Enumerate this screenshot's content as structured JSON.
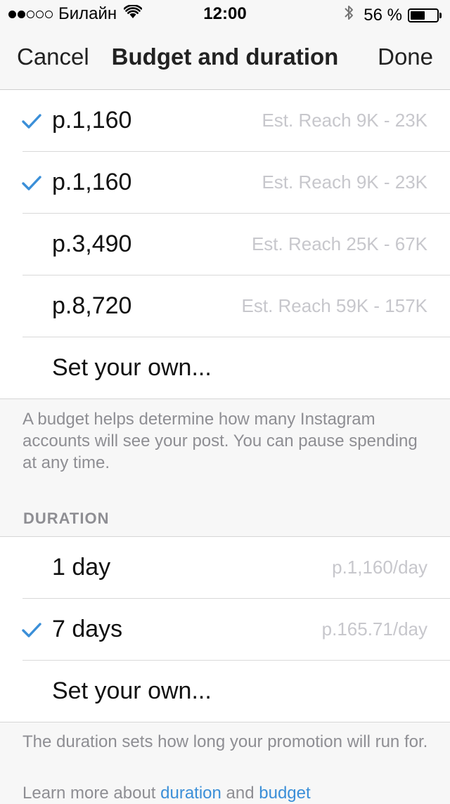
{
  "status_bar": {
    "carrier": "Билайн",
    "time": "12:00",
    "battery_percent": "56 %",
    "battery_level": 0.56,
    "signal_dots_filled": 2,
    "signal_dots_total": 5
  },
  "nav": {
    "cancel_label": "Cancel",
    "title": "Budget and duration",
    "done_label": "Done"
  },
  "budget": {
    "options": [
      {
        "label": "p.1,160",
        "detail": "Est. Reach 9K - 23K",
        "checked": true
      },
      {
        "label": "p.1,160",
        "detail": "Est. Reach 9K - 23K",
        "checked": true
      },
      {
        "label": "p.3,490",
        "detail": "Est. Reach 25K - 67K",
        "checked": false
      },
      {
        "label": "p.8,720",
        "detail": "Est. Reach 59K - 157K",
        "checked": false
      }
    ],
    "set_own_label": "Set your own...",
    "footer": "A budget helps determine how many Instagram accounts will see your post. You can pause spending at any time."
  },
  "duration": {
    "header": "DURATION",
    "options": [
      {
        "label": "1 day",
        "detail": "p.1,160/day",
        "checked": false
      },
      {
        "label": "7 days",
        "detail": "p.165.71/day",
        "checked": true
      }
    ],
    "set_own_label": "Set your own...",
    "footer": "The duration sets how long your promotion will run for.",
    "learn_more_prefix": "Learn more about ",
    "learn_more_link1": "duration",
    "learn_more_and": " and ",
    "learn_more_link2": "budget"
  },
  "colors": {
    "accent": "#3b8fd8",
    "secondary_text": "#8e8e93",
    "detail_text": "#c7c7cc"
  },
  "icons": {
    "check": "check-icon",
    "wifi": "wifi-icon",
    "bluetooth": "bluetooth-icon",
    "battery": "battery-icon"
  }
}
